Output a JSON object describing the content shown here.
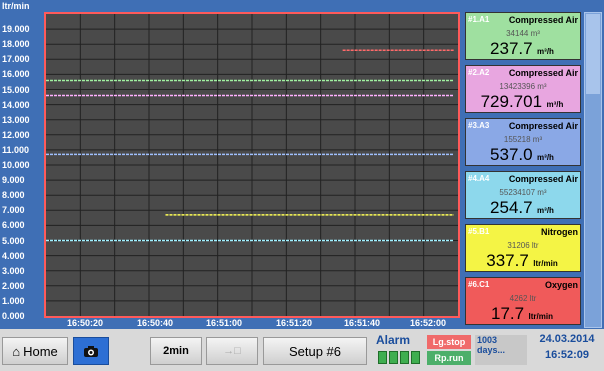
{
  "chart": {
    "unit_label": "ltr/min",
    "y_ticks": [
      "19.000",
      "18.000",
      "17.000",
      "16.000",
      "15.000",
      "14.000",
      "13.000",
      "12.000",
      "11.000",
      "10.000",
      "9.000",
      "8.000",
      "7.000",
      "6.000",
      "5.000",
      "4.000",
      "3.000",
      "2.000",
      "1.000",
      "0.000"
    ],
    "x_ticks": [
      "16:50:20",
      "16:50:40",
      "16:51:00",
      "16:51:20",
      "16:51:40",
      "16:52:00"
    ]
  },
  "chart_data": {
    "type": "line",
    "ylabel": "ltr/min",
    "ylim": [
      0,
      20
    ],
    "x": [
      "16:50:20",
      "16:50:40",
      "16:51:00",
      "16:51:20",
      "16:51:40",
      "16:52:00"
    ],
    "series": [
      {
        "color": "#ff6a6a",
        "x_start": 0.72,
        "x_end": 0.99,
        "value": 17.6
      },
      {
        "color": "#a0f0a0",
        "x_start": 0.0,
        "x_end": 0.99,
        "value": 15.6
      },
      {
        "color": "#ffb0ff",
        "x_start": 0.0,
        "x_end": 0.99,
        "value": 14.6
      },
      {
        "color": "#a0c0ff",
        "x_start": 0.0,
        "x_end": 0.99,
        "value": 10.7
      },
      {
        "color": "#ffff55",
        "x_start": 0.29,
        "x_end": 0.99,
        "value": 6.7
      },
      {
        "color": "#a0f0ff",
        "x_start": 0.0,
        "x_end": 0.99,
        "value": 5.0
      }
    ],
    "grid": true
  },
  "cards": [
    {
      "id": "#1.A1",
      "name": "Compressed Air",
      "total": "34144 m³",
      "value": "237.7",
      "unit": "m³/h",
      "bg": "#9fe0a0"
    },
    {
      "id": "#2.A2",
      "name": "Compressed Air",
      "total": "13423396 m³",
      "value": "729.701",
      "unit": "m³/h",
      "bg": "#e8a6e0"
    },
    {
      "id": "#3.A3",
      "name": "Compressed Air",
      "total": "155218 m³",
      "value": "537.0",
      "unit": "m³/h",
      "bg": "#8aa8e6"
    },
    {
      "id": "#4.A4",
      "name": "Compressed Air",
      "total": "55234107 m³",
      "value": "254.7",
      "unit": "m³/h",
      "bg": "#8dd8ec"
    },
    {
      "id": "#5.B1",
      "name": "Nitrogen",
      "total": "31206 ltr",
      "value": "337.7",
      "unit": "ltr/min",
      "bg": "#f4f445"
    },
    {
      "id": "#6.C1",
      "name": "Oxygen",
      "total": "4262 ltr",
      "value": "17.7",
      "unit": "ltr/min",
      "bg": "#f05a5a"
    }
  ],
  "toolbar": {
    "home_label": "Home",
    "interval_label": "2min",
    "arrow_label": "→□",
    "setup_label": "Setup #6",
    "alarm_label": "Alarm",
    "lg_stop": "Lg.stop",
    "rp_run": "Rp.run",
    "days": "1003 days...",
    "date": "24.03.2014",
    "time": "16:52:09"
  }
}
